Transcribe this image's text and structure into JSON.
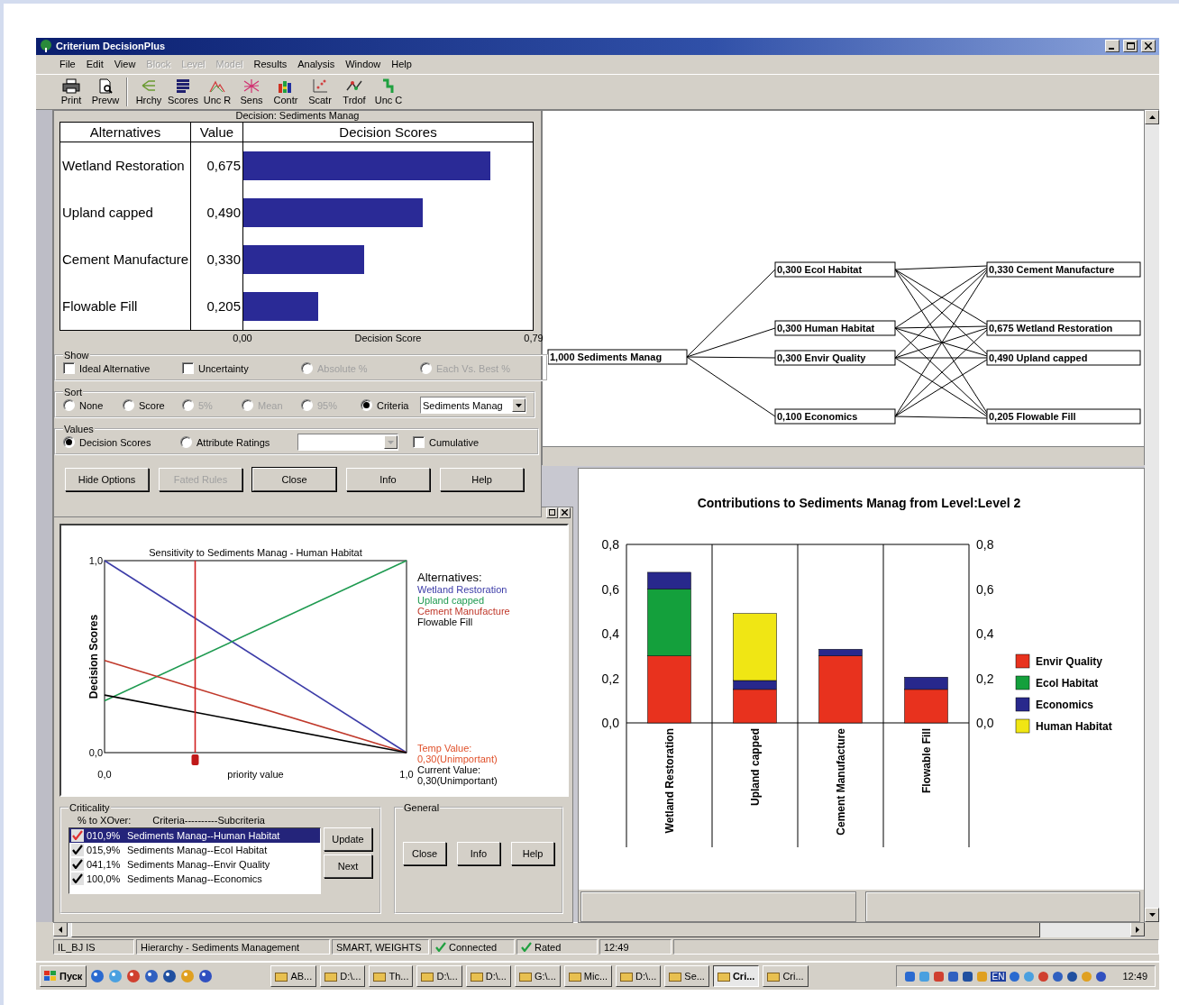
{
  "window": {
    "title": "Criterium DecisionPlus"
  },
  "menu": [
    {
      "label": "File",
      "disabled": false
    },
    {
      "label": "Edit",
      "disabled": false
    },
    {
      "label": "View",
      "disabled": false
    },
    {
      "label": "Block",
      "disabled": true
    },
    {
      "label": "Level",
      "disabled": true
    },
    {
      "label": "Model",
      "disabled": true
    },
    {
      "label": "Results",
      "disabled": false
    },
    {
      "label": "Analysis",
      "disabled": false
    },
    {
      "label": "Window",
      "disabled": false
    },
    {
      "label": "Help",
      "disabled": false
    }
  ],
  "toolbar": [
    {
      "label": "Print",
      "kind": "print"
    },
    {
      "label": "Prevw",
      "kind": "preview"
    },
    {
      "label": "Hrchy",
      "kind": "hierarchy"
    },
    {
      "label": "Scores",
      "kind": "scores"
    },
    {
      "label": "Unc R",
      "kind": "uncertainty"
    },
    {
      "label": "Sens",
      "kind": "sensitivity"
    },
    {
      "label": "Contr",
      "kind": "contributions"
    },
    {
      "label": "Scatr",
      "kind": "scatter"
    },
    {
      "label": "Trdof",
      "kind": "tradeoff"
    },
    {
      "label": "Unc C",
      "kind": "step"
    }
  ],
  "scores_window": {
    "title": "Decision: Sediments Manag",
    "columns": [
      "Alternatives",
      "Value",
      "Decision Scores"
    ],
    "chart_data": {
      "type": "bar",
      "orientation": "horizontal",
      "xlabel": "Decision Score",
      "categories": [
        "Wetland Restoration",
        "Upland capped",
        "Cement Manufacture",
        "Flowable Fill"
      ],
      "values": [
        0.675,
        0.49,
        0.33,
        0.205
      ],
      "grid": true,
      "value_labels": [
        "0,675",
        "0,490",
        "0,330",
        "0,205"
      ],
      "xlim": [
        0,
        0.79
      ],
      "xticks": [
        {
          "value": 0,
          "label": "0,00"
        },
        {
          "value": 0.79,
          "label": "0,79"
        }
      ]
    },
    "show": {
      "label": "Show",
      "options": [
        {
          "label": "Ideal Alternative",
          "kind": "checkbox",
          "checked": false,
          "disabled": false
        },
        {
          "label": "Uncertainty",
          "kind": "checkbox",
          "checked": false,
          "disabled": false
        },
        {
          "label": "Absolute %",
          "kind": "radio",
          "selected": false,
          "disabled": true
        },
        {
          "label": "Each Vs. Best %",
          "kind": "radio",
          "selected": false,
          "disabled": true
        }
      ]
    },
    "sort": {
      "label": "Sort",
      "options": [
        {
          "label": "None",
          "kind": "radio",
          "selected": false,
          "disabled": false
        },
        {
          "label": "Score",
          "kind": "radio",
          "selected": false,
          "disabled": false
        },
        {
          "label": "5%",
          "kind": "radio",
          "selected": false,
          "disabled": true
        },
        {
          "label": "Mean",
          "kind": "radio",
          "selected": false,
          "disabled": true
        },
        {
          "label": "95%",
          "kind": "radio",
          "selected": false,
          "disabled": true
        },
        {
          "label": "Criteria",
          "kind": "radio",
          "selected": true,
          "disabled": false
        }
      ],
      "dropdown": "Sediments Manag"
    },
    "values": {
      "label": "Values",
      "options": [
        {
          "label": "Decision Scores",
          "kind": "radio",
          "selected": true,
          "disabled": false
        },
        {
          "label": "Attribute Ratings",
          "kind": "radio",
          "selected": false,
          "disabled": false
        },
        {
          "label": "Cumulative",
          "kind": "checkbox",
          "checked": false,
          "disabled": false
        }
      ]
    },
    "buttons": [
      {
        "label": "Hide Options",
        "disabled": false,
        "focused": false
      },
      {
        "label": "Fated Rules",
        "disabled": true,
        "focused": false
      },
      {
        "label": "Close",
        "disabled": false,
        "focused": true
      },
      {
        "label": "Info",
        "disabled": false,
        "focused": false
      },
      {
        "label": "Help",
        "disabled": false,
        "focused": false
      }
    ]
  },
  "sensitivity_window": {
    "chart_data": {
      "type": "line",
      "title": "Sensitivity to Sediments Manag - Human Habitat",
      "xlabel": "priority value",
      "ylabel": "Decision Scores",
      "x": [
        0,
        1
      ],
      "series": [
        {
          "name": "Wetland Restoration",
          "color": "#3c3ca8",
          "values": [
            1.0,
            0.0
          ]
        },
        {
          "name": "Upland capped",
          "color": "#1e9a50",
          "values": [
            0.27,
            1.0
          ]
        },
        {
          "name": "Cement Manufacture",
          "color": "#c0392b",
          "values": [
            0.48,
            0.0
          ]
        },
        {
          "name": "Flowable Fill",
          "color": "#000000",
          "values": [
            0.3,
            0.0
          ]
        }
      ],
      "xlim": [
        0,
        1
      ],
      "ylim": [
        0,
        1
      ],
      "xticks": [
        {
          "value": 0,
          "label": "0,0"
        },
        {
          "value": 1,
          "label": "1,0"
        }
      ],
      "yticks": [
        {
          "value": 0,
          "label": "0,0"
        },
        {
          "value": 1,
          "label": "1,0"
        }
      ],
      "ref_lines": [
        {
          "axis": "x",
          "value": 0.3,
          "color": "#d02020"
        }
      ],
      "legend": "right"
    },
    "legend_title": "Alternatives:",
    "readouts": [
      {
        "text": "Temp Value:",
        "kind": "temp"
      },
      {
        "text": "0,30(Unimportant)",
        "kind": "temp"
      },
      {
        "text": "Current Value:",
        "kind": "current"
      },
      {
        "text": "0,30(Unimportant)",
        "kind": "current"
      }
    ],
    "criticality": {
      "label": "Criticality",
      "header": [
        "% to XOver:",
        "Criteria----------Subcriteria"
      ],
      "items": [
        {
          "percent": "010,9%",
          "label": "Sediments Manag--Human Habitat",
          "checked": true,
          "selected": true
        },
        {
          "percent": "015,9%",
          "label": "Sediments Manag--Ecol Habitat",
          "checked": true,
          "selected": false
        },
        {
          "percent": "041,1%",
          "label": "Sediments Manag--Envir Quality",
          "checked": true,
          "selected": false
        },
        {
          "percent": "100,0%",
          "label": "Sediments Manag--Economics",
          "checked": true,
          "selected": false
        }
      ],
      "buttons": [
        "Update",
        "Next"
      ]
    },
    "general": {
      "label": "General",
      "buttons": [
        "Close",
        "Info",
        "Help"
      ]
    }
  },
  "hierarchy": {
    "root": "1,000 Sediments Manag",
    "criteria": [
      "0,300 Ecol Habitat",
      "0,300 Human Habitat",
      "0,300 Envir Quality",
      "0,100 Economics"
    ],
    "alternatives": [
      "0,330 Cement Manufacture",
      "0,675 Wetland Restoration",
      "0,490 Upland capped",
      "0,205 Flowable Fill"
    ]
  },
  "contributions": {
    "chart_data": {
      "type": "bar",
      "stacked": true,
      "title": "Contributions to Sediments Manag from Level:Level 2",
      "categories": [
        "Wetland Restoration",
        "Upland capped",
        "Cement Manufacture",
        "Flowable Fill"
      ],
      "series": [
        {
          "name": "Envir Quality",
          "color": "#e8321e",
          "values": [
            0.3,
            0.15,
            0.3,
            0.15
          ]
        },
        {
          "name": "Ecol Habitat",
          "color": "#14a03c",
          "values": [
            0.3,
            0,
            0,
            0
          ]
        },
        {
          "name": "Economics",
          "color": "#28288c",
          "values": [
            0.075,
            0.04,
            0.03,
            0.055
          ]
        },
        {
          "name": "Human Habitat",
          "color": "#f0e614",
          "values": [
            0,
            0.3,
            0,
            0
          ]
        }
      ],
      "ylim": [
        0,
        0.8
      ],
      "yticks": [
        {
          "value": 0,
          "label": "0,0"
        },
        {
          "value": 0.2,
          "label": "0,2"
        },
        {
          "value": 0.4,
          "label": "0,4"
        },
        {
          "value": 0.6,
          "label": "0,6"
        },
        {
          "value": 0.8,
          "label": "0,8"
        }
      ],
      "legend": "right"
    }
  },
  "status_bar": [
    {
      "text": "IL_BJ IS",
      "checked": false
    },
    {
      "text": "Hierarchy - Sediments Management",
      "checked": false
    },
    {
      "text": "SMART, WEIGHTS",
      "checked": false
    },
    {
      "text": "Connected",
      "checked": true
    },
    {
      "text": "Rated",
      "checked": true
    },
    {
      "text": "12:49",
      "checked": false
    }
  ],
  "taskbar": {
    "start": "Пуск",
    "tasks": [
      {
        "label": "AB...",
        "selected": false
      },
      {
        "label": "D:\\...",
        "selected": false
      },
      {
        "label": "Th...",
        "selected": false
      },
      {
        "label": "D:\\...",
        "selected": false
      },
      {
        "label": "D:\\...",
        "selected": false
      },
      {
        "label": "G:\\...",
        "selected": false
      },
      {
        "label": "Mic...",
        "selected": false
      },
      {
        "label": "D:\\...",
        "selected": false
      },
      {
        "label": "Se...",
        "selected": false
      },
      {
        "label": "Cri...",
        "selected": true
      },
      {
        "label": "Cri...",
        "selected": false
      }
    ],
    "language": "EN",
    "clock": "12:49"
  }
}
